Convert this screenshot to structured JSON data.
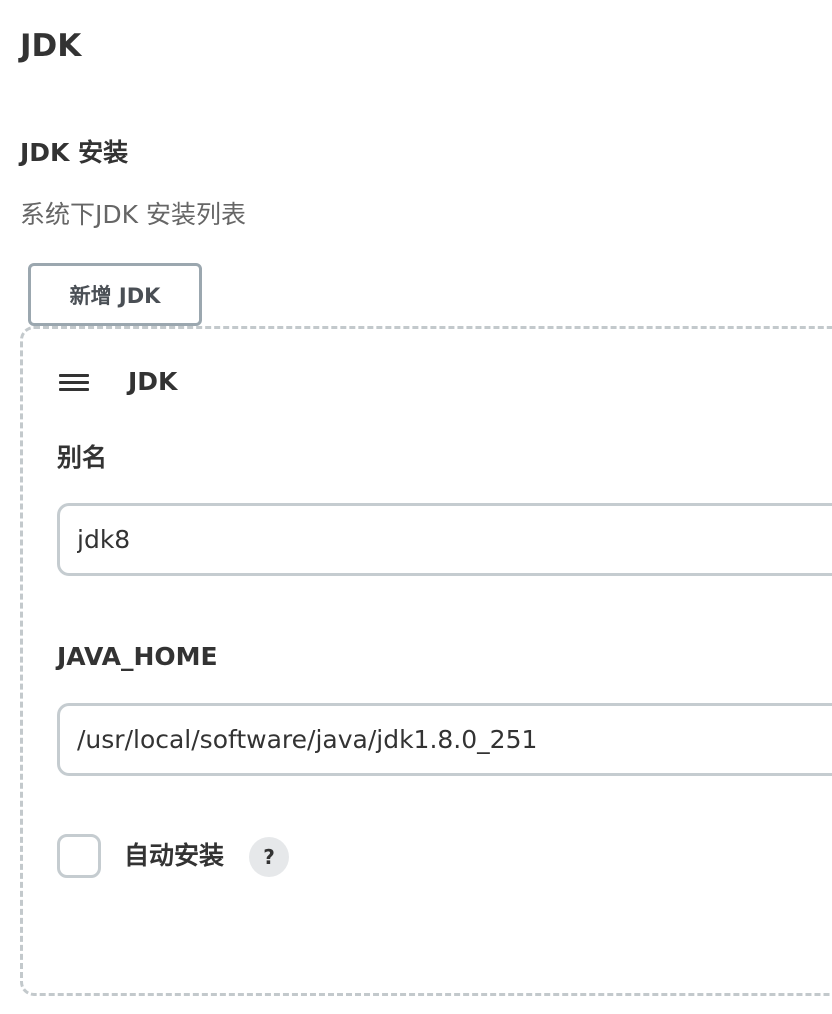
{
  "section": {
    "title": "JDK"
  },
  "jdk_installations": {
    "title": "JDK 安装",
    "description": "系统下JDK 安装列表",
    "add_button_label": "新增 JDK",
    "items": [
      {
        "header": "JDK",
        "name_label": "别名",
        "name_value": "jdk8",
        "java_home_label": "JAVA_HOME",
        "java_home_value": "/usr/local/software/java/jdk1.8.0_251",
        "auto_install_label": "自动安装",
        "auto_install_checked": false,
        "help_icon_glyph": "?",
        "drag_handle_icon": "hamburger-menu-icon"
      }
    ]
  },
  "colors": {
    "text": "#333333",
    "muted_text": "#666666",
    "border": "#c5ccd0",
    "dashed_border": "#c3c9cc",
    "button_border": "#9ba7af",
    "help_bg": "#e6e8ea"
  }
}
